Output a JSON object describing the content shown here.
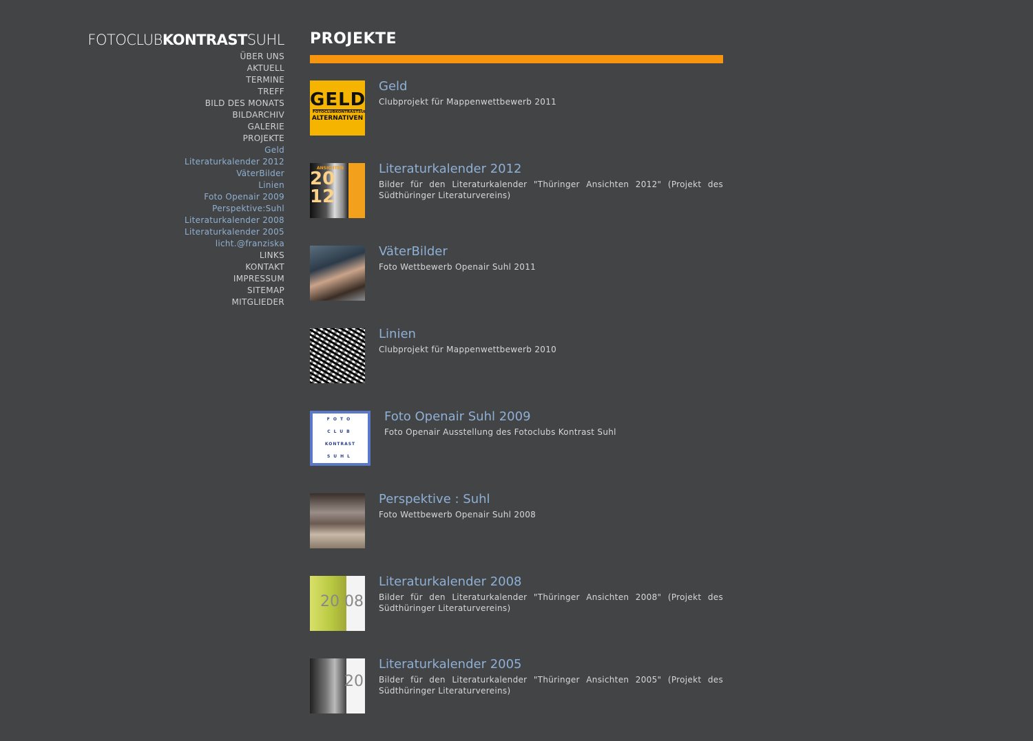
{
  "logo": {
    "part1": "FOTOCLUB",
    "part2": "KONTRAST",
    "part3": "SUHL"
  },
  "nav": [
    {
      "label": "ÜBER UNS",
      "type": "main"
    },
    {
      "label": "AKTUELL",
      "type": "main"
    },
    {
      "label": "TERMINE",
      "type": "main"
    },
    {
      "label": "TREFF",
      "type": "main"
    },
    {
      "label": "BILD DES MONATS",
      "type": "main"
    },
    {
      "label": "BILDARCHIV",
      "type": "main"
    },
    {
      "label": "GALERIE",
      "type": "main"
    },
    {
      "label": "PROJEKTE",
      "type": "main"
    },
    {
      "label": "Geld",
      "type": "sub"
    },
    {
      "label": "Literaturkalender 2012",
      "type": "sub"
    },
    {
      "label": "VäterBilder",
      "type": "sub"
    },
    {
      "label": "Linien",
      "type": "sub"
    },
    {
      "label": "Foto Openair 2009",
      "type": "sub"
    },
    {
      "label": "Perspektive:Suhl",
      "type": "sub"
    },
    {
      "label": "Literaturkalender 2008",
      "type": "sub"
    },
    {
      "label": "Literaturkalender 2005",
      "type": "sub"
    },
    {
      "label": "licht.@franziska",
      "type": "sub"
    },
    {
      "label": "LINKS",
      "type": "main"
    },
    {
      "label": "KONTAKT",
      "type": "main"
    },
    {
      "label": "IMPRESSUM",
      "type": "main"
    },
    {
      "label": "SITEMAP",
      "type": "main"
    },
    {
      "label": "MITGLIEDER",
      "type": "main"
    }
  ],
  "page_title": "PROJEKTE",
  "thumb_text": {
    "geld_line1": "GELD",
    "geld_line2": "FOTOCLUBKONTRASTSUHL",
    "geld_line3": "ALTERNATIVEN",
    "lit12_label": "ANSICHTEN",
    "lit12_year": "20 12",
    "openair_lines": [
      "FOTO",
      "CLUB",
      "KONTRAST",
      "SUHL"
    ],
    "lit08_year": "20 08",
    "lit05_year": "20"
  },
  "projects": [
    {
      "title": "Geld",
      "desc": "Clubprojekt für Mappenwettbewerb 2011"
    },
    {
      "title": "Literaturkalender 2012",
      "desc": "Bilder für den Literaturkalender \"Thüringer Ansichten 2012\" (Projekt des Südthüringer Literaturvereins)"
    },
    {
      "title": "VäterBilder",
      "desc": "Foto Wettbewerb Openair Suhl 2011"
    },
    {
      "title": "Linien",
      "desc": "Clubprojekt für Mappenwettbewerb 2010"
    },
    {
      "title": "Foto Openair Suhl 2009",
      "desc": "Foto Openair Ausstellung des Fotoclubs Kontrast Suhl"
    },
    {
      "title": "Perspektive : Suhl",
      "desc": "Foto Wettbewerb Openair Suhl 2008"
    },
    {
      "title": "Literaturkalender 2008",
      "desc": "Bilder für den Literaturkalender \"Thüringer Ansichten 2008\" (Projekt des Südthüringer Literaturvereins)"
    },
    {
      "title": "Literaturkalender 2005",
      "desc": "Bilder für den Literaturkalender \"Thüringer Ansichten 2005\" (Projekt des Südthüringer Literaturvereins)"
    }
  ],
  "colors": {
    "background": "#434446",
    "accent_bar": "#f7950e",
    "link": "#8fb0d6"
  }
}
